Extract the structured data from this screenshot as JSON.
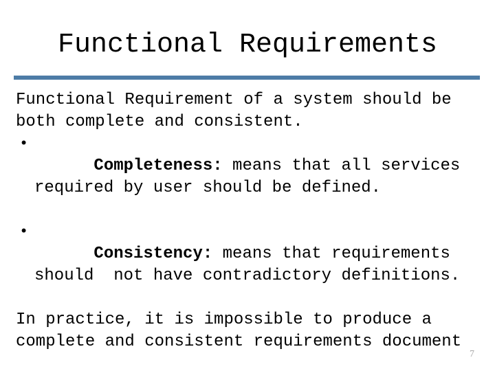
{
  "slide": {
    "title": "Functional Requirements",
    "divider_color": "#4d7ca6",
    "page_number": "7",
    "page_number_color": "#a6a6a6",
    "body": {
      "intro": "Functional Requirement of a system should be both complete and consistent.",
      "bullets": [
        {
          "marker": "bullet-dot",
          "label": "Completeness:",
          "text": " means that all services required by user should be defined."
        },
        {
          "marker": "bullet-dot",
          "label": "Consistency:",
          "text": " means that requirements should  not have contradictory definitions."
        }
      ],
      "outro": "In practice, it is impossible to produce a complete and consistent requirements document"
    }
  }
}
